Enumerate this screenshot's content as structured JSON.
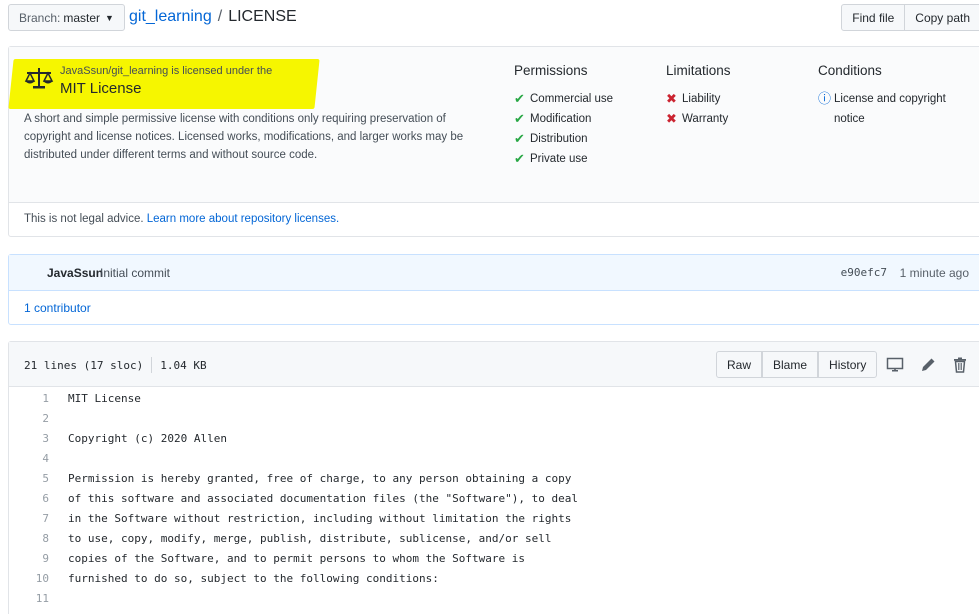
{
  "topbar": {
    "branch_prefix": "Branch:",
    "branch_name": "master",
    "repo": "git_learning",
    "separator": "/",
    "file": "LICENSE",
    "find_file": "Find file",
    "copy_path": "Copy path"
  },
  "license": {
    "subtitle": "JavaSsun/git_learning is licensed under the",
    "name": "MIT License",
    "description": "A short and simple permissive license with conditions only requiring preservation of copyright and license notices. Licensed works, modifications, and larger works may be distributed under different terms and without source code.",
    "permissions_title": "Permissions",
    "permissions": [
      "Commercial use",
      "Modification",
      "Distribution",
      "Private use"
    ],
    "limitations_title": "Limitations",
    "limitations": [
      "Liability",
      "Warranty"
    ],
    "conditions_title": "Conditions",
    "conditions": [
      "License and copyright notice"
    ],
    "disclaimer": "This is not legal advice.",
    "learn_more": "Learn more about repository licenses.",
    "highlight_color": "#f6f600"
  },
  "commit": {
    "author": "JavaSsun",
    "message": "Initial commit",
    "sha": "e90efc7",
    "time": "1 minute ago",
    "contributors": "1 contributor"
  },
  "file": {
    "lines_info": "21 lines (17 sloc)",
    "size": "1.04 KB",
    "raw": "Raw",
    "blame": "Blame",
    "history": "History",
    "icons": [
      "desktop-icon",
      "pencil-icon",
      "trash-icon"
    ],
    "code": [
      {
        "n": "1",
        "text": "MIT License"
      },
      {
        "n": "2",
        "text": ""
      },
      {
        "n": "3",
        "text": "Copyright (c) 2020 Allen"
      },
      {
        "n": "4",
        "text": ""
      },
      {
        "n": "5",
        "text": "Permission is hereby granted, free of charge, to any person obtaining a copy"
      },
      {
        "n": "6",
        "text": "of this software and associated documentation files (the \"Software\"), to deal"
      },
      {
        "n": "7",
        "text": "in the Software without restriction, including without limitation the rights"
      },
      {
        "n": "8",
        "text": "to use, copy, modify, merge, publish, distribute, sublicense, and/or sell"
      },
      {
        "n": "9",
        "text": "copies of the Software, and to permit persons to whom the Software is"
      },
      {
        "n": "10",
        "text": "furnished to do so, subject to the following conditions:"
      },
      {
        "n": "11",
        "text": ""
      }
    ]
  }
}
